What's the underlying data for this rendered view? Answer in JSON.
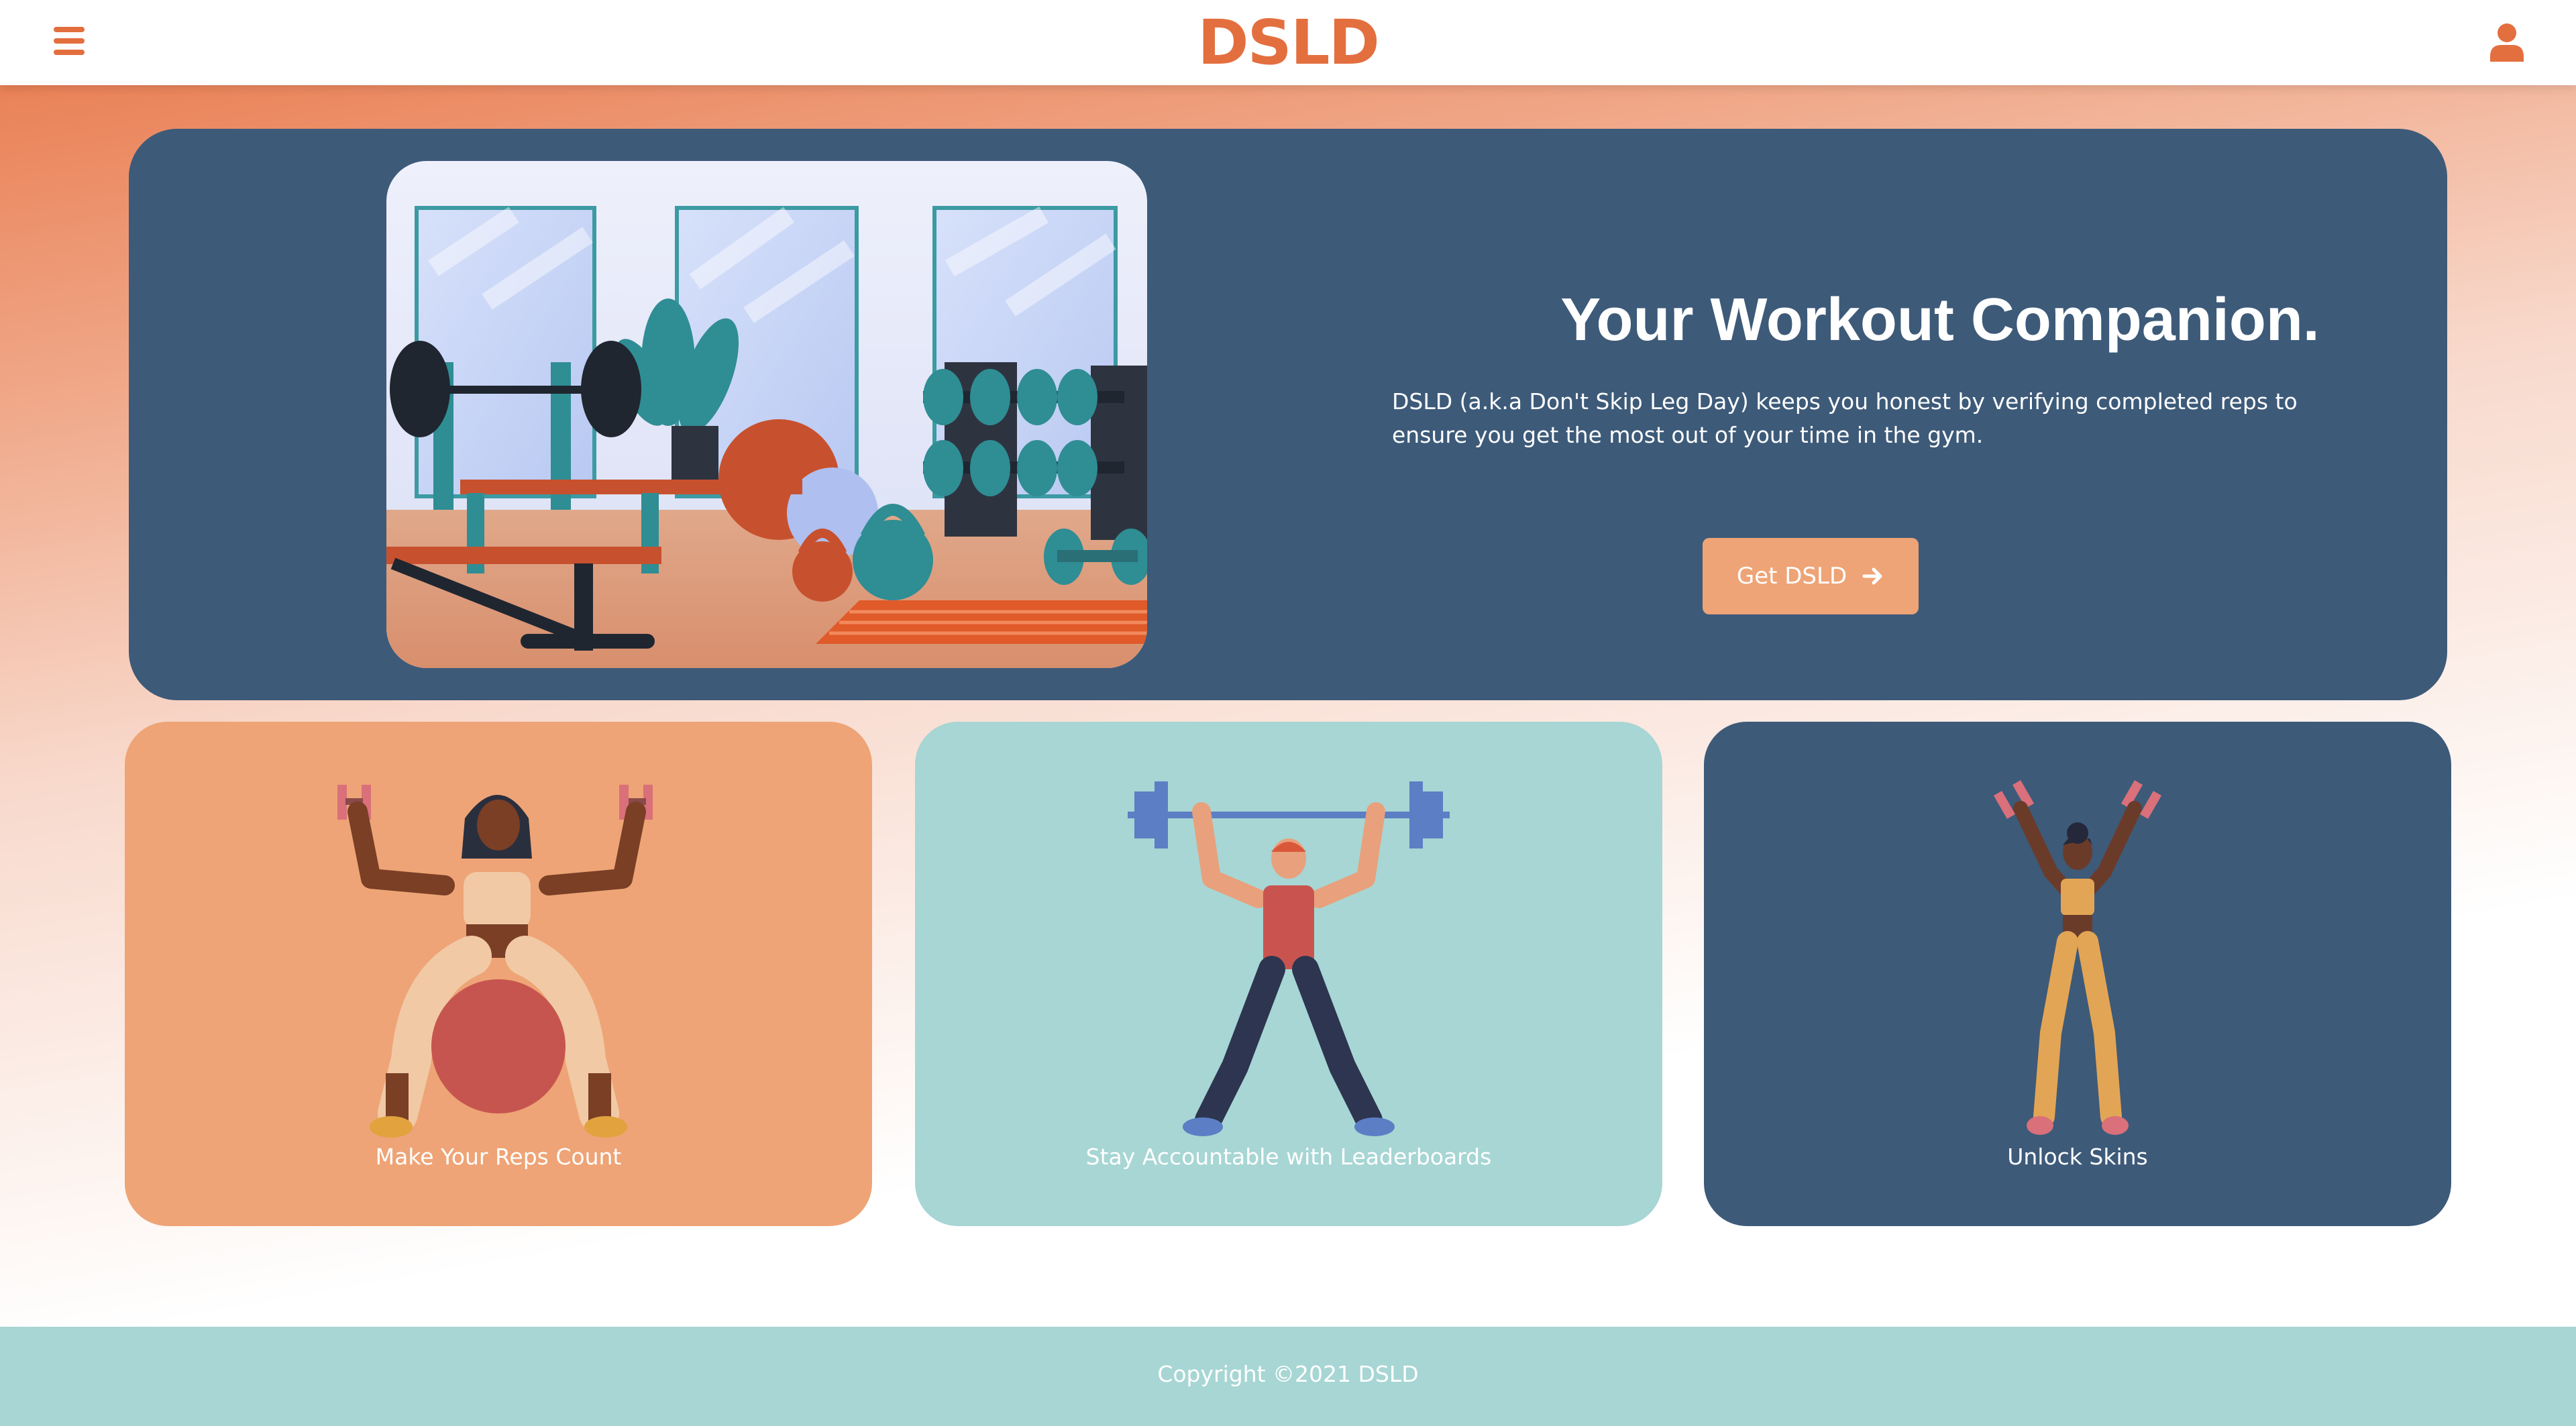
{
  "header": {
    "logo": "DSLD",
    "menu_icon": "hamburger-menu-icon",
    "account_icon": "user-icon"
  },
  "hero": {
    "title": "Your Workout Companion.",
    "description": "DSLD (a.k.a Don't Skip Leg Day) keeps you honest by verifying completed reps to ensure you get the most out of your time in the gym.",
    "cta_label": "Get DSLD",
    "cta_icon": "arrow-right-icon",
    "illustration": "gym-interior-illustration"
  },
  "features": [
    {
      "label": "Make Your Reps Count",
      "illustration": "woman-on-exercise-ball-illustration",
      "color": "#eea476"
    },
    {
      "label": "Stay Accountable with Leaderboards",
      "illustration": "man-lifting-barbell-illustration",
      "color": "#a7d6d4"
    },
    {
      "label": "Unlock Skins",
      "illustration": "woman-raising-dumbbells-illustration",
      "color": "#3d5a79"
    }
  ],
  "footer": {
    "copyright": "Copyright ©2021 DSLD"
  },
  "colors": {
    "brand_orange": "#e36f3f",
    "navy": "#3d5a79",
    "peach": "#eea476",
    "teal": "#a7d6d4"
  }
}
